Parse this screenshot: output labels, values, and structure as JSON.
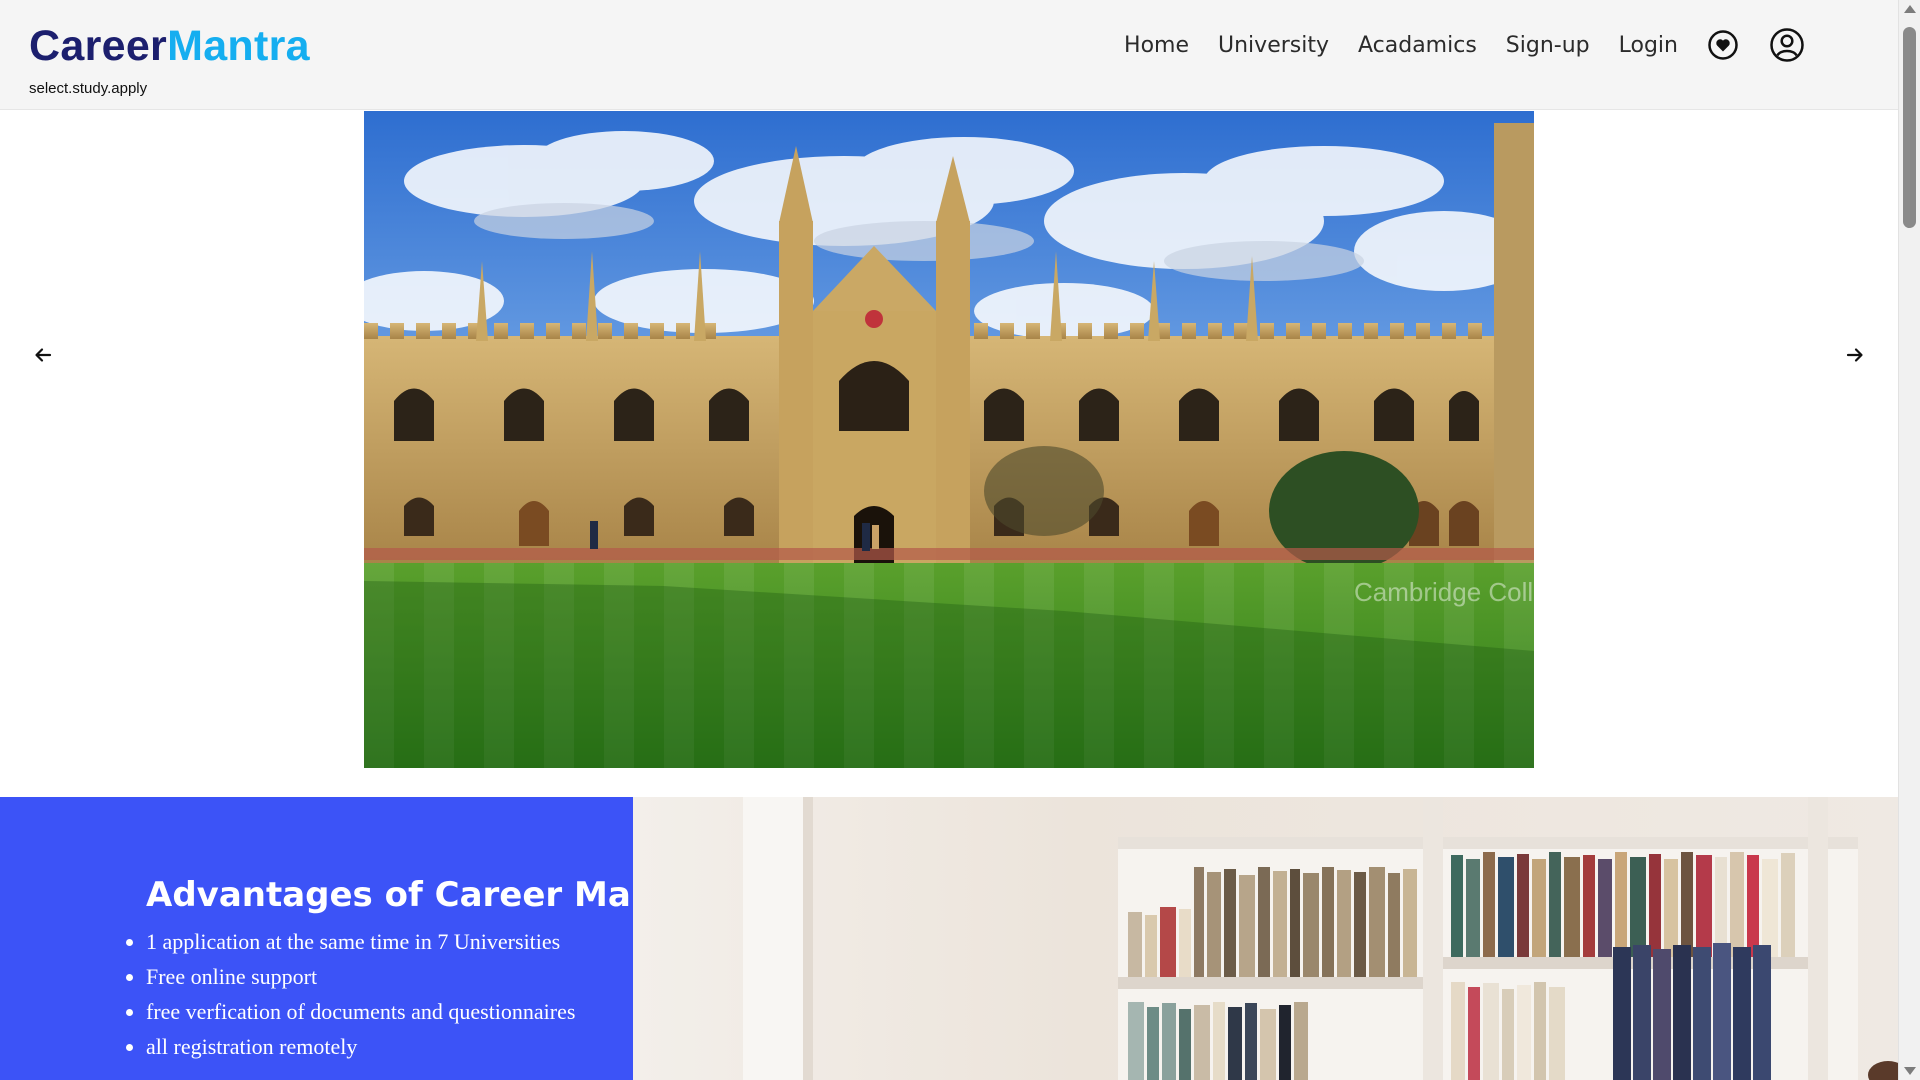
{
  "brand": {
    "name_part1": "Career",
    "name_part2": "Mantra",
    "tagline": "select.study.apply",
    "primary_color": "#1c1f6e",
    "accent_color": "#15aef0"
  },
  "nav": {
    "links": [
      "Home",
      "University",
      "Acadamics",
      "Sign-up",
      "Login"
    ],
    "icons": [
      "heart-icon",
      "user-account-icon"
    ]
  },
  "carousel": {
    "prev_icon": "arrow-left-icon",
    "next_icon": "arrow-right-icon",
    "slide_watermark": "Cambridge Colleges"
  },
  "advantages": {
    "title": "Advantages of Career Mantra",
    "items": [
      "1 application at the same time in 7 Universities",
      "Free online support",
      "free verfication of documents and questionnaires",
      "all registration remotely"
    ],
    "panel_color": "#3c53f7"
  }
}
